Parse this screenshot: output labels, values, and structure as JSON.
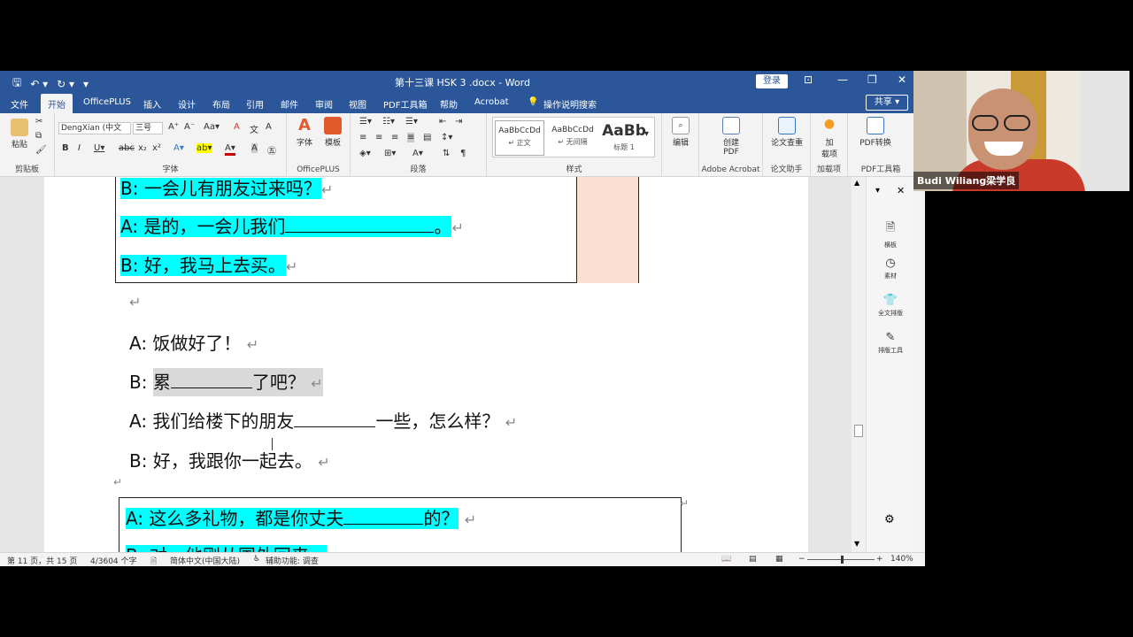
{
  "window": {
    "title": "第十三课   HSK  3 .docx  -  Word",
    "login": "登录",
    "share": "共享"
  },
  "tabs": [
    "文件",
    "开始",
    "OfficePLUS",
    "插入",
    "设计",
    "布局",
    "引用",
    "邮件",
    "审阅",
    "视图",
    "PDF工具箱",
    "帮助",
    "Acrobat",
    "操作说明搜索"
  ],
  "ribbon": {
    "clipboard": {
      "paste": "粘贴",
      "label": "剪贴板"
    },
    "font": {
      "family": "DengXian (中文",
      "size": "三号",
      "label": "字体"
    },
    "officeplus": {
      "font_btn": "字体",
      "template_btn": "模板",
      "label": "OfficePLUS"
    },
    "paragraph": {
      "label": "段落"
    },
    "styles": {
      "items": [
        {
          "sample": "AaBbCcDd",
          "name": "↵ 正文"
        },
        {
          "sample": "AaBbCcDd",
          "name": "↵ 无间隔"
        },
        {
          "sample": "AaBb",
          "name": "标题 1"
        }
      ],
      "label": "样式"
    },
    "editing": {
      "label": "编辑"
    },
    "adobe": {
      "create_pdf_line1": "创建",
      "create_pdf_line2": "PDF",
      "label": "Adobe Acrobat"
    },
    "thesis": {
      "check": "论文查重",
      "label": "论文助手"
    },
    "addins": {
      "line1": "加",
      "line2": "载项",
      "label": "加载项"
    },
    "pdf": {
      "convert": "PDF转换",
      "label": "PDF工具箱"
    }
  },
  "side_pane": [
    "横板",
    "素材",
    "全文排版",
    "排版工具"
  ],
  "document": {
    "box1": {
      "line1": "B:    一会儿有朋友过来吗？",
      "line2_a": "A:    是的，一会儿我们",
      "line2_b": "。",
      "line3": "B:    好，我马上去买。"
    },
    "dialog": {
      "l1": "A:  饭做好了！",
      "l2_a": "B:  ",
      "l2_b": "累",
      "l2_c": "了吧？",
      "l3_a": "A:  我们给楼下的朋友",
      "l3_b": "一些，怎么样？",
      "l4": "B:  好，我跟你一起去。"
    },
    "box2": {
      "l1_a": "A:  这么多礼物，都是你丈夫",
      "l1_b": "的？",
      "l2": "B:  对，他刚从国外回来。"
    },
    "return_mark": "↵"
  },
  "status": {
    "page": "第 11 页，共 15 页",
    "words": "4/3604 个字",
    "lang": "简体中文(中国大陆)",
    "access": "辅助功能: 调查",
    "zoom": "140%"
  },
  "video": {
    "name": "Budi Wiliang梁学良"
  }
}
